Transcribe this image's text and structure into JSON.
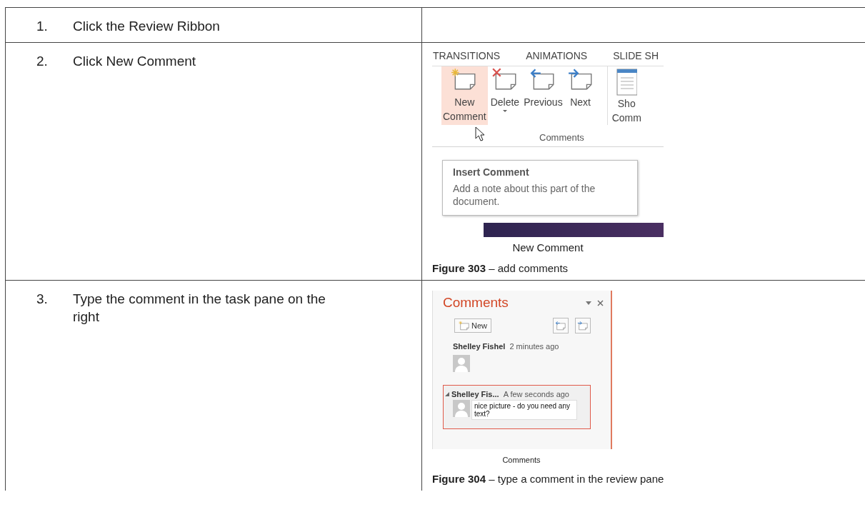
{
  "steps": [
    {
      "number": "1.",
      "text": "Click the Review Ribbon"
    },
    {
      "number": "2.",
      "text": "Click New Comment",
      "figure": {
        "kind": "ribbon",
        "tabs": [
          "TRANSITIONS",
          "ANIMATIONS",
          "SLIDE SH"
        ],
        "buttons": [
          {
            "kind": "new",
            "lines": [
              "New",
              "Comment"
            ],
            "selected": true,
            "has_menu": false
          },
          {
            "kind": "delete",
            "lines": [
              "Delete"
            ],
            "selected": false,
            "has_menu": true
          },
          {
            "kind": "previous",
            "lines": [
              "Previous"
            ],
            "selected": false,
            "has_menu": false
          },
          {
            "kind": "next",
            "lines": [
              "Next"
            ],
            "selected": false,
            "has_menu": false
          },
          {
            "kind": "show",
            "lines": [
              "Sho",
              "Comm"
            ],
            "selected": false,
            "has_menu": false
          }
        ],
        "group": "Comments",
        "tooltip": {
          "title": "Insert Comment",
          "body": "Add a note about this part of the document."
        },
        "inner_caption": "New Comment",
        "caption": "**Figure 303** – add comments"
      }
    },
    {
      "number": "3.",
      "text": "Type the comment in the task pane on the right",
      "figure": {
        "kind": "pane",
        "title": "Comments",
        "new_button": "New",
        "comments": [
          {
            "author": "Shelley Fishel",
            "time": "2 minutes ago",
            "selected": false
          },
          {
            "author": "Shelley Fis...",
            "time": "A few seconds ago",
            "selected": true,
            "value": "nice picture - do you need any text?"
          }
        ],
        "inner_caption": "Comments",
        "caption": "**Figure 304** – type a comment in the review pane"
      }
    }
  ]
}
